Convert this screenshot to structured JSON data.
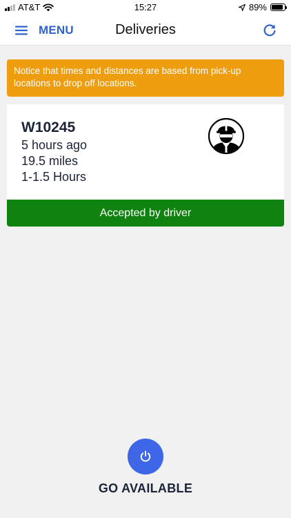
{
  "status_bar": {
    "carrier": "AT&T",
    "time": "15:27",
    "battery_percent": "89%",
    "battery_level": 0.89,
    "icons": [
      "signal-icon",
      "wifi-icon",
      "location-arrow-icon",
      "battery-icon"
    ]
  },
  "header": {
    "menu_label": "MENU",
    "title": "Deliveries",
    "icons": [
      "hamburger-icon",
      "refresh-icon"
    ]
  },
  "notice": {
    "text": "Notice that times and distances are based from pick-up locations to drop off locations."
  },
  "delivery": {
    "order_id": "W10245",
    "posted": "5 hours ago",
    "distance": "19.5 miles",
    "duration": "1-1.5 Hours",
    "status": "Accepted by driver",
    "avatar_icon": "driver-hardhat-icon"
  },
  "availability": {
    "label": "GO AVAILABLE",
    "icon": "power-icon"
  },
  "colors": {
    "accent": "#2f63d2",
    "notice": "#ee9d0f",
    "accepted": "#0f8210",
    "go_button": "#3d67e6",
    "background": "#f1f1f2"
  }
}
